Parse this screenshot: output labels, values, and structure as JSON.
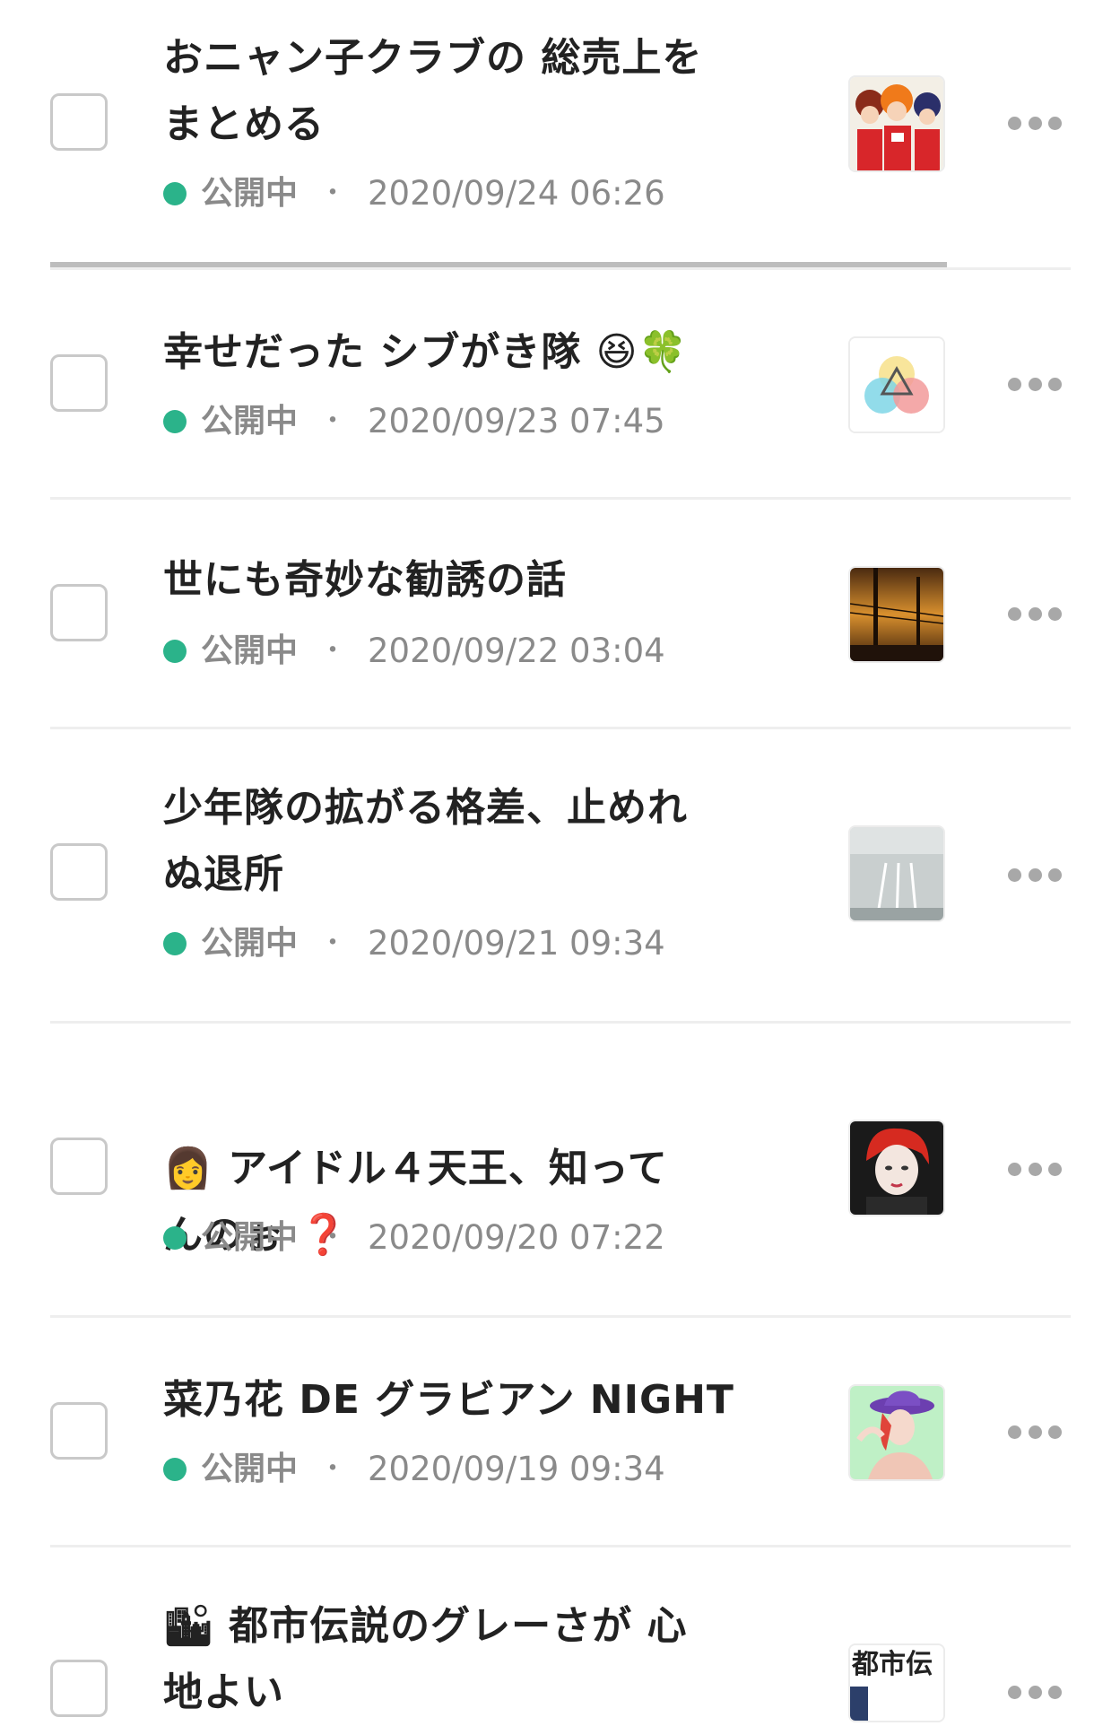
{
  "items": [
    {
      "title": "おニャン子クラブの 総売上を\nまとめる",
      "status": "公開中",
      "separator": "・",
      "date": "2020/09/24 06:26",
      "thumbnail": "group-idol-illustration"
    },
    {
      "title": "幸せだった シブがき隊 😆🍀",
      "status": "公開中",
      "separator": "・",
      "date": "2020/09/23 07:45",
      "thumbnail": "triangle-circles-logo"
    },
    {
      "title": "世にも奇妙な勧誘の話",
      "status": "公開中",
      "separator": "・",
      "date": "2020/09/22 03:04",
      "thumbnail": "sunset-powerline-photo"
    },
    {
      "title": "少年隊の拡がる格差、止めれ\nぬ退所",
      "status": "公開中",
      "separator": "・",
      "date": "2020/09/21 09:34",
      "thumbnail": "road-photo"
    },
    {
      "title": "👩 アイドル４天王、知って\nんのぉ ❓",
      "status": "公開中",
      "separator": "・",
      "date": "2020/09/20 07:22",
      "thumbnail": "red-hair-woman-illustration"
    },
    {
      "title": "菜乃花 DE グラビアン NIGHT",
      "status": "公開中",
      "separator": "・",
      "date": "2020/09/19 09:34",
      "thumbnail": "purple-hat-woman-illustration"
    },
    {
      "title": "🏙 都市伝説のグレーさが 心\n地よい",
      "status": "",
      "separator": "",
      "date": "",
      "thumbnail": "city-legend-text-image",
      "thumbnail_text": "都市伝"
    }
  ],
  "colors": {
    "status_dot": "#2bb38a",
    "divider": "#eeeeee",
    "text": "#222222",
    "meta": "#8a8a8a"
  }
}
